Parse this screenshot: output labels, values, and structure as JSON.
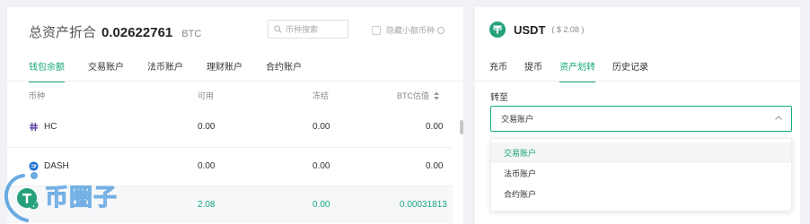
{
  "header": {
    "title": "总资产折合",
    "total_value": "0.02622761",
    "unit": "BTC",
    "search_placeholder": "币种搜索",
    "hide_small_label": "隐藏小额币种"
  },
  "tabs": [
    {
      "label": "钱包余额",
      "active": true
    },
    {
      "label": "交易账户",
      "active": false
    },
    {
      "label": "法币账户",
      "active": false
    },
    {
      "label": "理财账户",
      "active": false
    },
    {
      "label": "合约账户",
      "active": false
    }
  ],
  "table": {
    "columns": [
      "币种",
      "可用",
      "冻结",
      "BTC估值"
    ],
    "rows": [
      {
        "coin": "HC",
        "available": "0.00",
        "frozen": "0.00",
        "btc": "0.00",
        "icon": "hc-icon",
        "highlighted": false
      },
      {
        "coin": "DASH",
        "available": "0.00",
        "frozen": "0.00",
        "btc": "0.00",
        "icon": "dash-icon",
        "highlighted": false
      },
      {
        "coin": "",
        "available": "2.08",
        "frozen": "0.00",
        "btc": "0.00031813",
        "icon": "usdt-icon",
        "highlighted": true
      }
    ]
  },
  "watermark": {
    "text": "币圈子"
  },
  "panel": {
    "coin": "USDT",
    "amount": "( $ 2.08 )",
    "tabs": [
      {
        "label": "充币",
        "active": false
      },
      {
        "label": "提币",
        "active": false
      },
      {
        "label": "资产划转",
        "active": true
      },
      {
        "label": "历史记录",
        "active": false
      }
    ],
    "to_label": "转至",
    "selected": "交易账户",
    "options": [
      "交易账户",
      "法币账户",
      "合约账户"
    ]
  },
  "colors": {
    "accent": "#16a77a",
    "usdt": "#26a17b",
    "hc": "#5a3fa0",
    "dash": "#1a6fd1"
  }
}
